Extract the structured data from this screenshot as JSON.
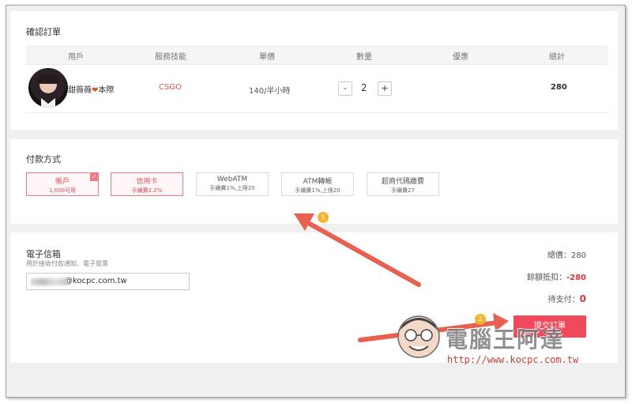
{
  "order": {
    "title": "確認訂單",
    "columns": [
      "用戶",
      "服務技能",
      "單價",
      "數量",
      "優惠",
      "總計"
    ],
    "row": {
      "user_name": "甜薇薇",
      "user_suffix": "本際",
      "skill": "CSGO",
      "unit_price": "140/半小時",
      "quantity": "2",
      "discount": "",
      "total": "280"
    },
    "minus_label": "-",
    "plus_label": "+"
  },
  "payment": {
    "title": "付款方式",
    "options": [
      {
        "name": "帳戶",
        "sub": "1,000可用",
        "selected": true
      },
      {
        "name": "信用卡",
        "sub": "手續費2.2%",
        "selected": false
      },
      {
        "name": "WebATM",
        "sub": "手續費1%,上限20",
        "selected": false
      },
      {
        "name": "ATM轉帳",
        "sub": "手續費1%,上限20",
        "selected": false
      },
      {
        "name": "超商代碼繳費",
        "sub": "手續費27",
        "selected": false
      }
    ],
    "check_icon": "✓"
  },
  "email": {
    "title": "電子信箱",
    "hint": "用於接收付款通知、電子發票",
    "value_visible": "@kocpc.com.tw"
  },
  "summary": {
    "total_label": "總價：",
    "total_value": "280",
    "balance_label": "餘額抵扣：",
    "balance_value": "-280",
    "due_label": "待支付：",
    "due_value": "0"
  },
  "submit_label": "提交訂單",
  "annotations": {
    "badge_1": "1",
    "badge_2": "2",
    "arrow_color": "#e8604f"
  },
  "watermark": {
    "text": "電腦王阿達",
    "url": "http://www.kocpc.com.tw"
  },
  "colors": {
    "accent": "#f0495a",
    "skill": "#e8534f",
    "selected_border": "#f07b85"
  }
}
